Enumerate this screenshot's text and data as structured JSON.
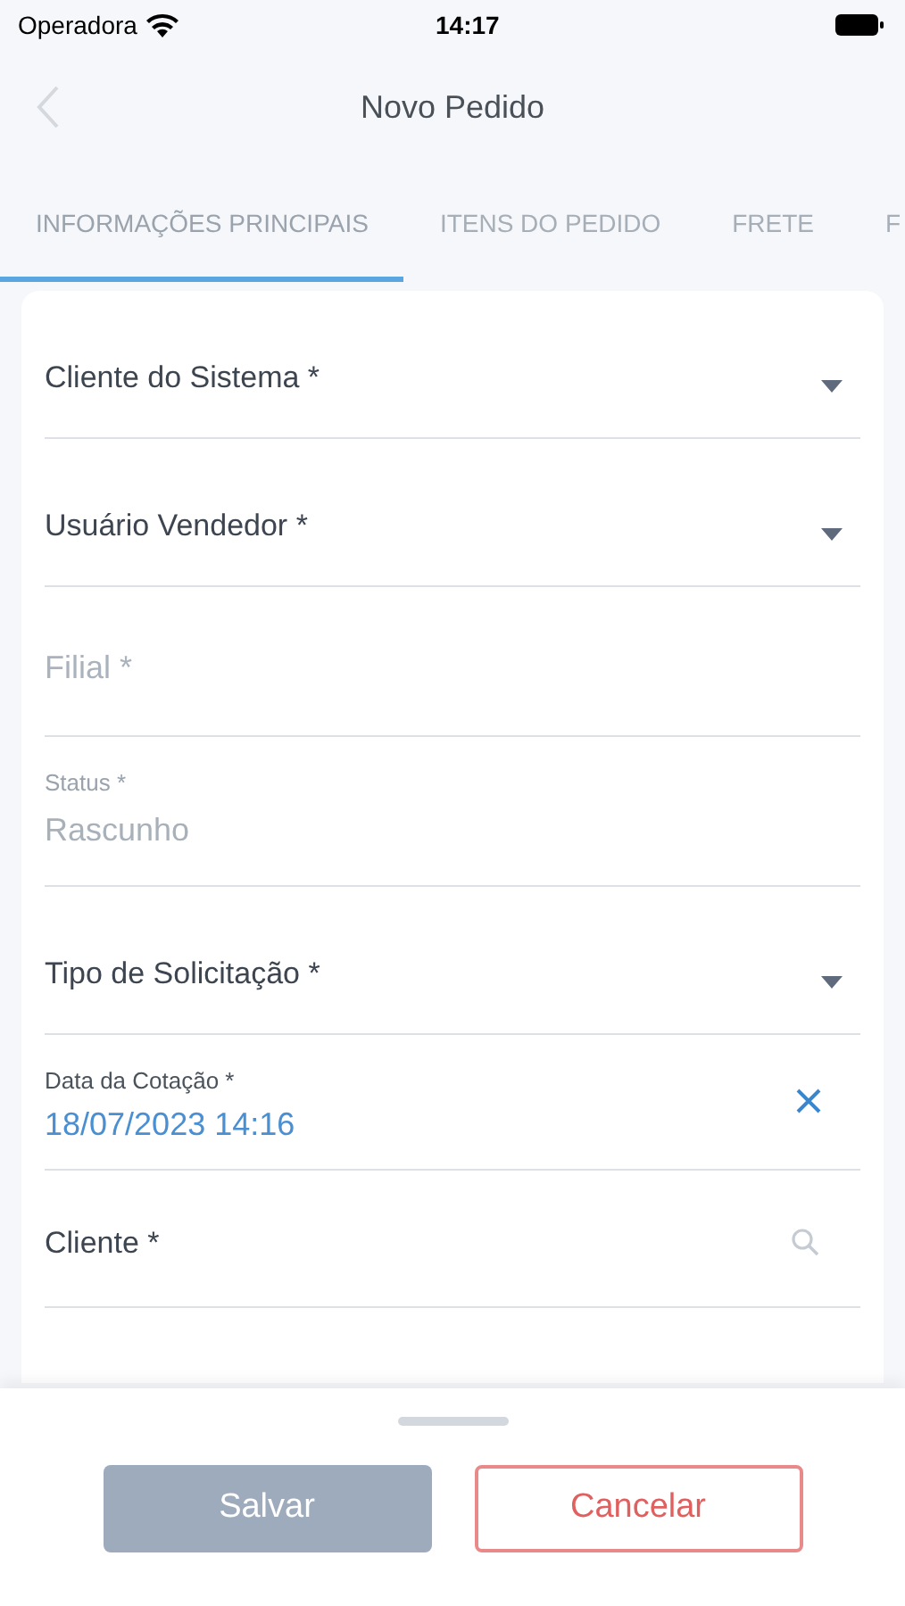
{
  "status_bar": {
    "carrier": "Operadora",
    "time": "14:17"
  },
  "header": {
    "title": "Novo Pedido"
  },
  "tabs": [
    {
      "label": "INFORMAÇÕES PRINCIPAIS",
      "selected": true
    },
    {
      "label": "ITENS DO PEDIDO",
      "selected": false
    },
    {
      "label": "FRETE",
      "selected": false
    },
    {
      "label": "F",
      "selected": false
    }
  ],
  "fields": [
    {
      "kind": "select",
      "label": "Cliente do Sistema *"
    },
    {
      "kind": "select",
      "label": "Usuário Vendedor *"
    },
    {
      "kind": "text",
      "placeholder": "Filial *"
    },
    {
      "kind": "readonly",
      "label": "Status *",
      "value": "Rascunho"
    },
    {
      "kind": "select",
      "label": "Tipo de Solicitação *"
    },
    {
      "kind": "date",
      "label": "Data da Cotação *",
      "value": "18/07/2023 14:16"
    },
    {
      "kind": "search",
      "label": "Cliente *"
    }
  ],
  "buttons": [
    {
      "label": "Salvar",
      "kind": "primary",
      "disabled": true
    },
    {
      "label": "Cancelar",
      "kind": "cancel",
      "disabled": false
    }
  ]
}
